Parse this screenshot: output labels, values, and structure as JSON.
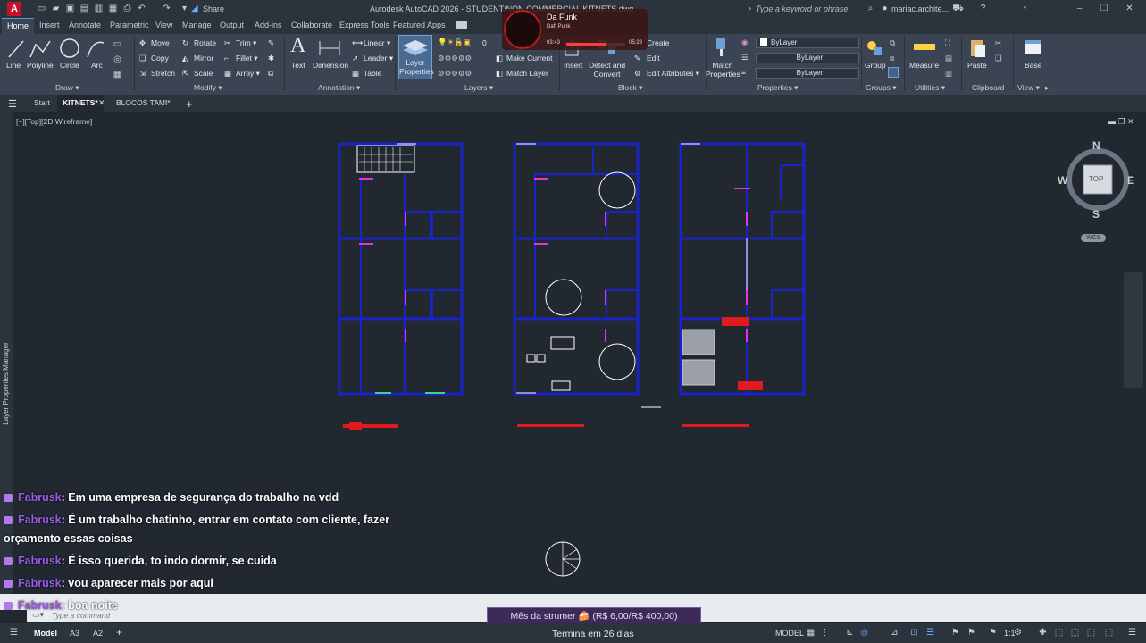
{
  "app": {
    "title": "Autodesk AutoCAD 2026 - STUDENT/NON COMMERCIAL    KITNETS.dwg",
    "logo": "A",
    "share_label": "Share",
    "search_placeholder": "Type a keyword or phrase",
    "user": "mariac.archite..."
  },
  "ribbon_tabs": [
    "Home",
    "Insert",
    "Annotate",
    "Parametric",
    "View",
    "Manage",
    "Output",
    "Add-ins",
    "Collaborate",
    "Express Tools",
    "Featured Apps"
  ],
  "ribbon": {
    "draw": {
      "title": "Draw ▾",
      "line": "Line",
      "polyline": "Polyline",
      "circle": "Circle",
      "arc": "Arc"
    },
    "modify": {
      "title": "Modify ▾",
      "move": "Move",
      "rotate": "Rotate",
      "trim": "Trim ▾",
      "copy": "Copy",
      "mirror": "Mirror",
      "fillet": "Fillet ▾",
      "stretch": "Stretch",
      "scale": "Scale",
      "array": "Array ▾"
    },
    "annotation": {
      "title": "Annotation ▾",
      "text": "Text",
      "dimension": "Dimension",
      "linear": "Linear ▾",
      "leader": "Leader ▾",
      "table": "Table"
    },
    "layers": {
      "title": "Layers ▾",
      "layer_properties": "Layer\nProperties",
      "layer_value": "0",
      "make_current": "Make Current",
      "match_layer": "Match Layer"
    },
    "block": {
      "title": "Block ▾",
      "insert": "Insert",
      "detect_convert": "Detect and\nConvert",
      "create": "Create",
      "edit": "Edit",
      "edit_attributes": "Edit Attributes ▾"
    },
    "properties": {
      "title": "Properties ▾",
      "match_properties": "Match\nProperties",
      "color": "ByLayer",
      "linetype": "ByLayer",
      "lineweight": "ByLayer"
    },
    "groups": {
      "title": "Groups ▾",
      "group": "Group"
    },
    "utilities": {
      "title": "Utilities ▾",
      "measure": "Measure"
    },
    "clipboard": {
      "title": "Clipboard",
      "paste": "Paste"
    },
    "view": {
      "title": "View ▾",
      "base": "Base"
    }
  },
  "doc_tabs": {
    "start": "Start",
    "kitnets": "KITNETS*",
    "blocos": "BLOCOS TAMI*",
    "add": "+"
  },
  "viewport": {
    "label": "[−][Top][2D Wireframe]"
  },
  "viewcube": {
    "n": "N",
    "s": "S",
    "e": "E",
    "w": "W",
    "top": "TOP",
    "wcs": "WCS"
  },
  "side_panel": {
    "label": "Layer Properties Manager"
  },
  "media": {
    "title": "Da Funk",
    "artist": "Daft Punk",
    "elapsed": "03:43",
    "duration": "05:28",
    "progress": 0.68
  },
  "chat": [
    {
      "user": "Fabrusk",
      "text": ": Em uma empresa de segurança do trabalho na vdd"
    },
    {
      "user": "Fabrusk",
      "text": ": É um trabalho chatinho, entrar em contato com cliente, fazer"
    },
    {
      "user": "",
      "text": "orçamento essas coisas"
    },
    {
      "user": "Fabrusk",
      "text": ": É isso querida, to indo dormir, se cuida"
    },
    {
      "user": "Fabrusk",
      "text": ": vou aparecer mais por aqui"
    },
    {
      "user": "Fabrusk",
      "text": ": boa noite"
    }
  ],
  "command": {
    "placeholder": "Type a command"
  },
  "overlay": {
    "subscription": "Mês da strumer 🍰 (R$ 6,00/R$ 400,00)",
    "ends": "Termina em 26 dias"
  },
  "status": {
    "model_tab": "Model",
    "a3": "A3",
    "a2": "A2",
    "model_label": "MODEL",
    "scale": "1:1"
  },
  "colors": {
    "plan_wall": "#1a23c8",
    "plan_line": "#ffffff",
    "accent_magenta": "#e632e6",
    "accent_red": "#e11b1b",
    "chat_user": "#9b59e8"
  }
}
